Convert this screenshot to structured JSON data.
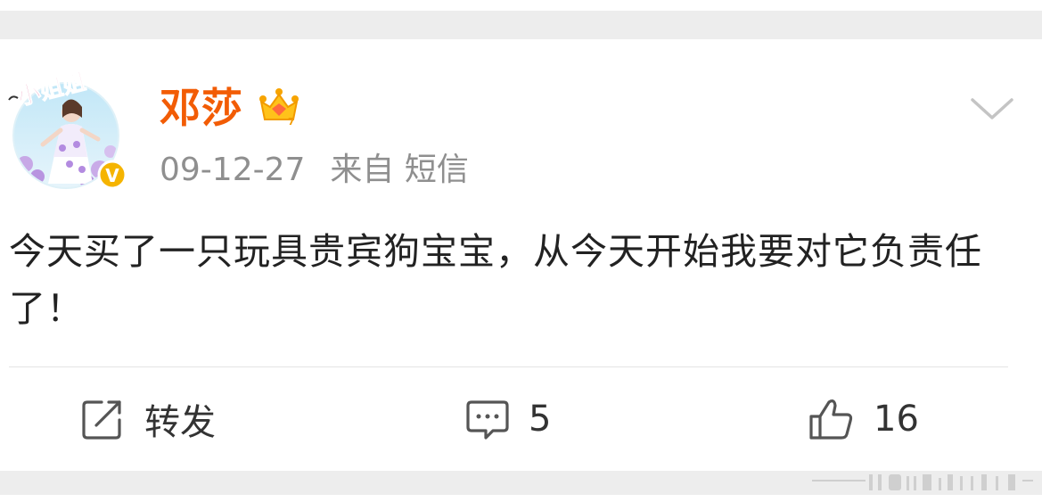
{
  "post": {
    "author": "邓莎",
    "date": "09-12-27",
    "source_prefix": "来自",
    "source": "短信",
    "text": "今天买了一只玩具贵宾狗宝宝，从今天开始我要对它负责任了！"
  },
  "avatar": {
    "frame_text": "小姐姐",
    "verified_badge": "V"
  },
  "actions": {
    "repost_label": "转发",
    "comment_count": "5",
    "like_count": "16"
  },
  "colors": {
    "name_orange": "#f25c05",
    "meta_gray": "#8f8f8f",
    "badge_yellow": "#f5b400",
    "background_gap": "#ededed"
  },
  "icons": {
    "crown": "crown-icon",
    "repost": "repost-icon",
    "comment": "comment-icon",
    "like": "like-icon",
    "dropdown": "chevron-down-icon",
    "verified": "verified-badge-icon"
  }
}
